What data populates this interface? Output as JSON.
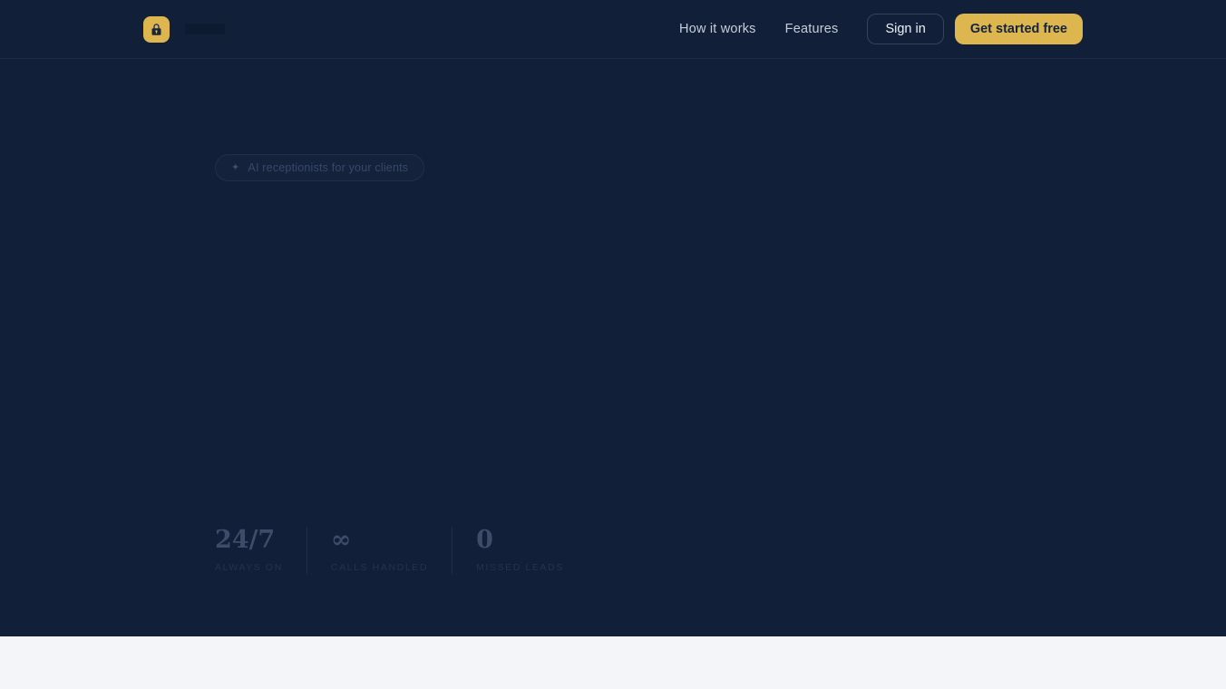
{
  "colors": {
    "background": "#111f38",
    "accent_gold": "#ddb64f",
    "light_section": "#f3f5f9"
  },
  "header": {
    "logo_icon": "lock-icon",
    "nav_items": [
      {
        "label": "How it works"
      },
      {
        "label": "Features"
      }
    ],
    "sign_in_label": "Sign in",
    "get_started_label": "Get started free"
  },
  "hero": {
    "badge": {
      "icon": "sparkle-icon",
      "text": "AI receptionists for your clients"
    },
    "stats": [
      {
        "value": "24/7",
        "label": "ALWAYS ON"
      },
      {
        "value": "∞",
        "label": "CALLS HANDLED"
      },
      {
        "value": "0",
        "label": "MISSED LEADS"
      }
    ]
  }
}
